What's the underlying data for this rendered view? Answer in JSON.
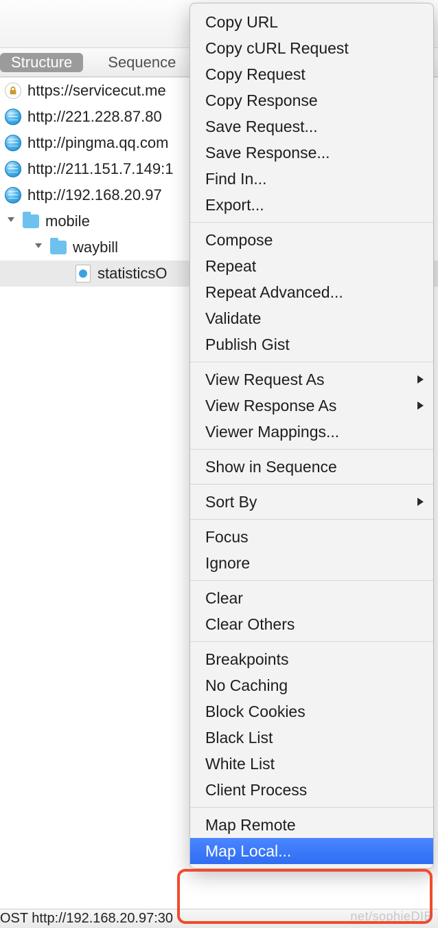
{
  "tabs": {
    "structure": "Structure",
    "sequence": "Sequence"
  },
  "hosts": [
    {
      "kind": "lock",
      "label": "https://servicecut.me"
    },
    {
      "kind": "globe",
      "label": "http://221.228.87.80"
    },
    {
      "kind": "globe",
      "label": "http://pingma.qq.com"
    },
    {
      "kind": "globe",
      "label": "http://211.151.7.149:1"
    },
    {
      "kind": "globe",
      "label": "http://192.168.20.97"
    }
  ],
  "tree": {
    "folder1": "mobile",
    "folder2": "waybill",
    "file": "statisticsO"
  },
  "menu_groups": [
    [
      "Copy URL",
      "Copy cURL Request",
      "Copy Request",
      "Copy Response",
      "Save Request...",
      "Save Response...",
      "Find In...",
      "Export..."
    ],
    [
      "Compose",
      "Repeat",
      "Repeat Advanced...",
      "Validate",
      "Publish Gist"
    ],
    [
      {
        "label": "View Request As",
        "sub": true
      },
      {
        "label": "View Response As",
        "sub": true
      },
      {
        "label": "Viewer Mappings..."
      }
    ],
    [
      "Show in Sequence"
    ],
    [
      {
        "label": "Sort By",
        "sub": true
      }
    ],
    [
      "Focus",
      "Ignore"
    ],
    [
      "Clear",
      "Clear Others"
    ],
    [
      "Breakpoints",
      "No Caching",
      "Block Cookies",
      "Black List",
      "White List",
      "Client Process"
    ],
    [
      "Map Remote",
      {
        "label": "Map Local...",
        "selected": true
      }
    ]
  ],
  "status": "OST http://192.168.20.97:30",
  "watermark": "net/sophieDIB"
}
